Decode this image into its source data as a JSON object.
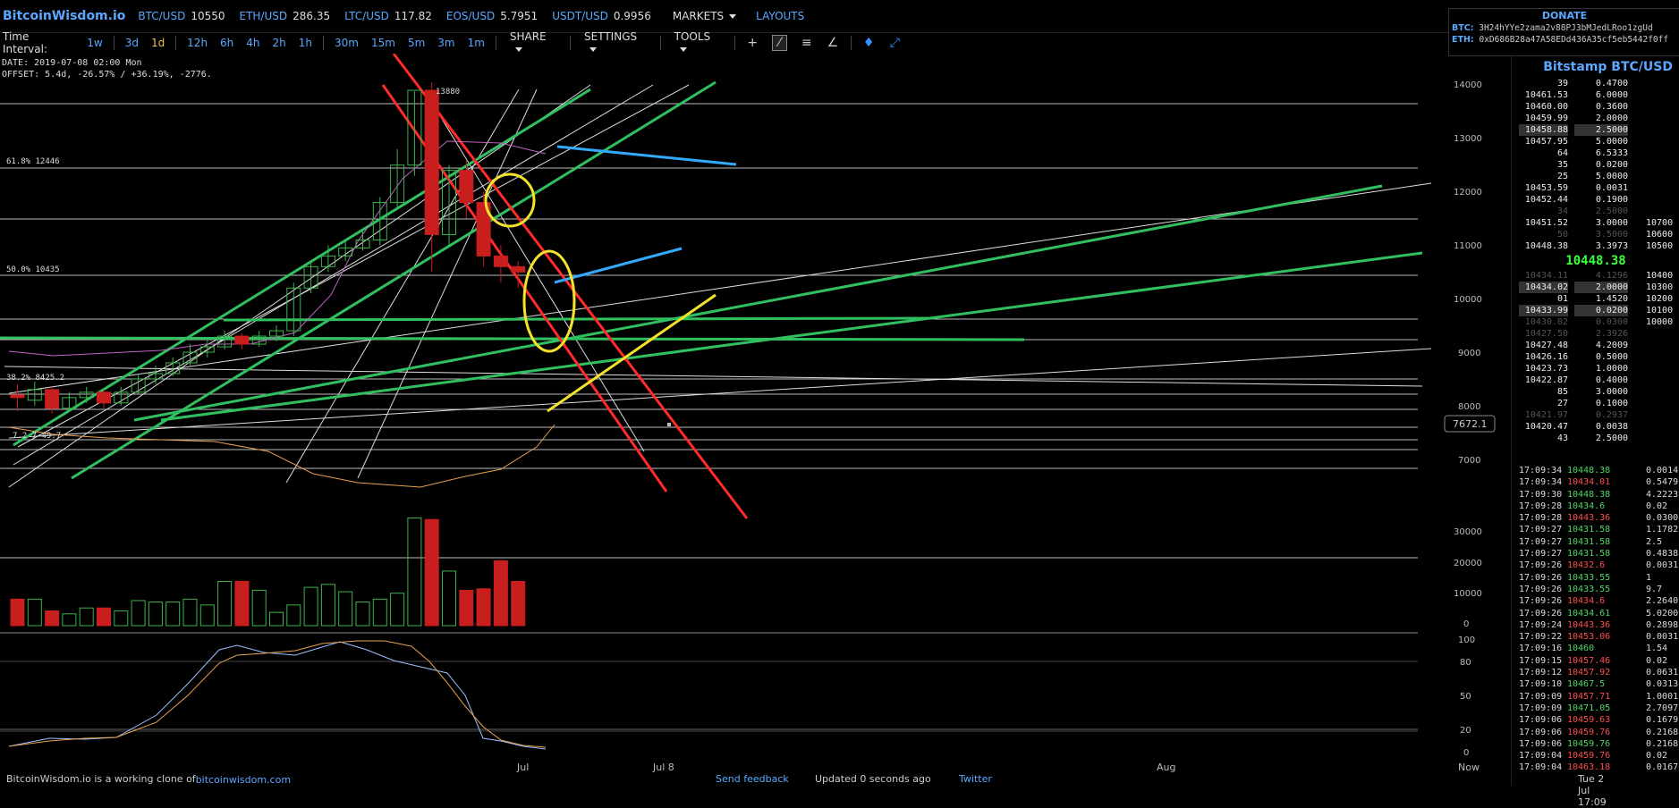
{
  "brand": "BitcoinWisdom.io",
  "tickers": [
    {
      "sym": "BTC/USD",
      "val": "10550"
    },
    {
      "sym": "ETH/USD",
      "val": "286.35"
    },
    {
      "sym": "LTC/USD",
      "val": "117.82"
    },
    {
      "sym": "EOS/USD",
      "val": "5.7951"
    },
    {
      "sym": "USDT/USD",
      "val": "0.9956"
    }
  ],
  "menus": {
    "markets": "MARKETS",
    "layouts": "LAYOUTS"
  },
  "toolbar": {
    "label": "Time Interval:",
    "intervals": [
      "1w",
      "3d",
      "1d",
      "12h",
      "6h",
      "4h",
      "2h",
      "1h",
      "30m",
      "15m",
      "5m",
      "3m",
      "1m"
    ],
    "active_interval": "1d",
    "share": "SHARE",
    "settings": "SETTINGS",
    "tools": "TOOLS"
  },
  "donate": {
    "title": "DONATE",
    "btc_label": "BTC:",
    "btc_addr": "3H24hYYe2zama2v88PJ3bMJedLRoo1zgUd",
    "eth_label": "ETH:",
    "eth_addr": "0xD686B28a47A58EDd436A35cf5eb5442f0ff"
  },
  "chart_info": {
    "date": "DATE: 2019-07-08 02:00 Mon",
    "offset": "OFFSET: 5.4d, -26.57% / +36.19%, -2776."
  },
  "price_axis": [
    "14000",
    "13000",
    "12000",
    "11000",
    "10000",
    "9000",
    "8000",
    "7000"
  ],
  "volume_axis": [
    "30000",
    "20000",
    "10000",
    "0"
  ],
  "osc_axis": [
    "100",
    "80",
    "50",
    "20",
    "0"
  ],
  "fib_labels": {
    "f618": "61.8% 12446",
    "f50": "50.0% 10435",
    "f382": "38.2% 8425.2",
    "low": "7.2 7·49.7"
  },
  "high_label": "13880",
  "price_tag": "7672.1",
  "x_labels": {
    "jul": "Jul",
    "jul8": "Jul 8",
    "aug": "Aug",
    "now": "Now"
  },
  "chart_data": {
    "type": "candlestick",
    "candles": [
      [
        8200,
        8150,
        8400,
        7900,
        "d"
      ],
      [
        8100,
        8300,
        8450,
        8000,
        "u"
      ],
      [
        8300,
        7950,
        8350,
        7850,
        "d"
      ],
      [
        7950,
        8150,
        8250,
        7900,
        "u"
      ],
      [
        8150,
        8250,
        8350,
        8050,
        "u"
      ],
      [
        8250,
        8050,
        8300,
        7950,
        "d"
      ],
      [
        8050,
        8250,
        8350,
        8000,
        "u"
      ],
      [
        8250,
        8500,
        8600,
        8200,
        "u"
      ],
      [
        8500,
        8600,
        8750,
        8400,
        "u"
      ],
      [
        8600,
        8800,
        8900,
        8550,
        "u"
      ],
      [
        8800,
        9000,
        9150,
        8750,
        "u"
      ],
      [
        9000,
        9100,
        9250,
        8900,
        "u"
      ],
      [
        9100,
        9300,
        9400,
        9050,
        "u"
      ],
      [
        9300,
        9150,
        9350,
        9050,
        "d"
      ],
      [
        9150,
        9300,
        9400,
        9100,
        "u"
      ],
      [
        9300,
        9400,
        9500,
        9200,
        "u"
      ],
      [
        9400,
        10200,
        10300,
        9300,
        "u"
      ],
      [
        10200,
        10600,
        10700,
        10100,
        "u"
      ],
      [
        10600,
        10800,
        11000,
        10500,
        "u"
      ],
      [
        10800,
        10950,
        11100,
        10700,
        "u"
      ],
      [
        10950,
        11100,
        11300,
        10900,
        "u"
      ],
      [
        11100,
        11800,
        11900,
        11000,
        "u"
      ],
      [
        11800,
        12500,
        12800,
        11700,
        "u"
      ],
      [
        12500,
        13900,
        13880,
        12300,
        "u"
      ],
      [
        13900,
        11200,
        14050,
        10500,
        "d"
      ],
      [
        11200,
        12400,
        12500,
        11000,
        "u"
      ],
      [
        12400,
        11800,
        12600,
        11500,
        "d"
      ],
      [
        11800,
        10800,
        12000,
        10600,
        "d"
      ],
      [
        10800,
        10600,
        11000,
        10300,
        "d"
      ],
      [
        10600,
        10500,
        10700,
        10200,
        "d"
      ]
    ],
    "volumes": [
      9000,
      9000,
      5000,
      4000,
      6000,
      6000,
      5000,
      8500,
      8000,
      8000,
      9000,
      7000,
      15000,
      15000,
      12000,
      4500,
      7000,
      13000,
      14000,
      11500,
      8000,
      9000,
      11000,
      36500,
      36000,
      18500,
      12000,
      12500,
      22000,
      15000
    ]
  }
}
